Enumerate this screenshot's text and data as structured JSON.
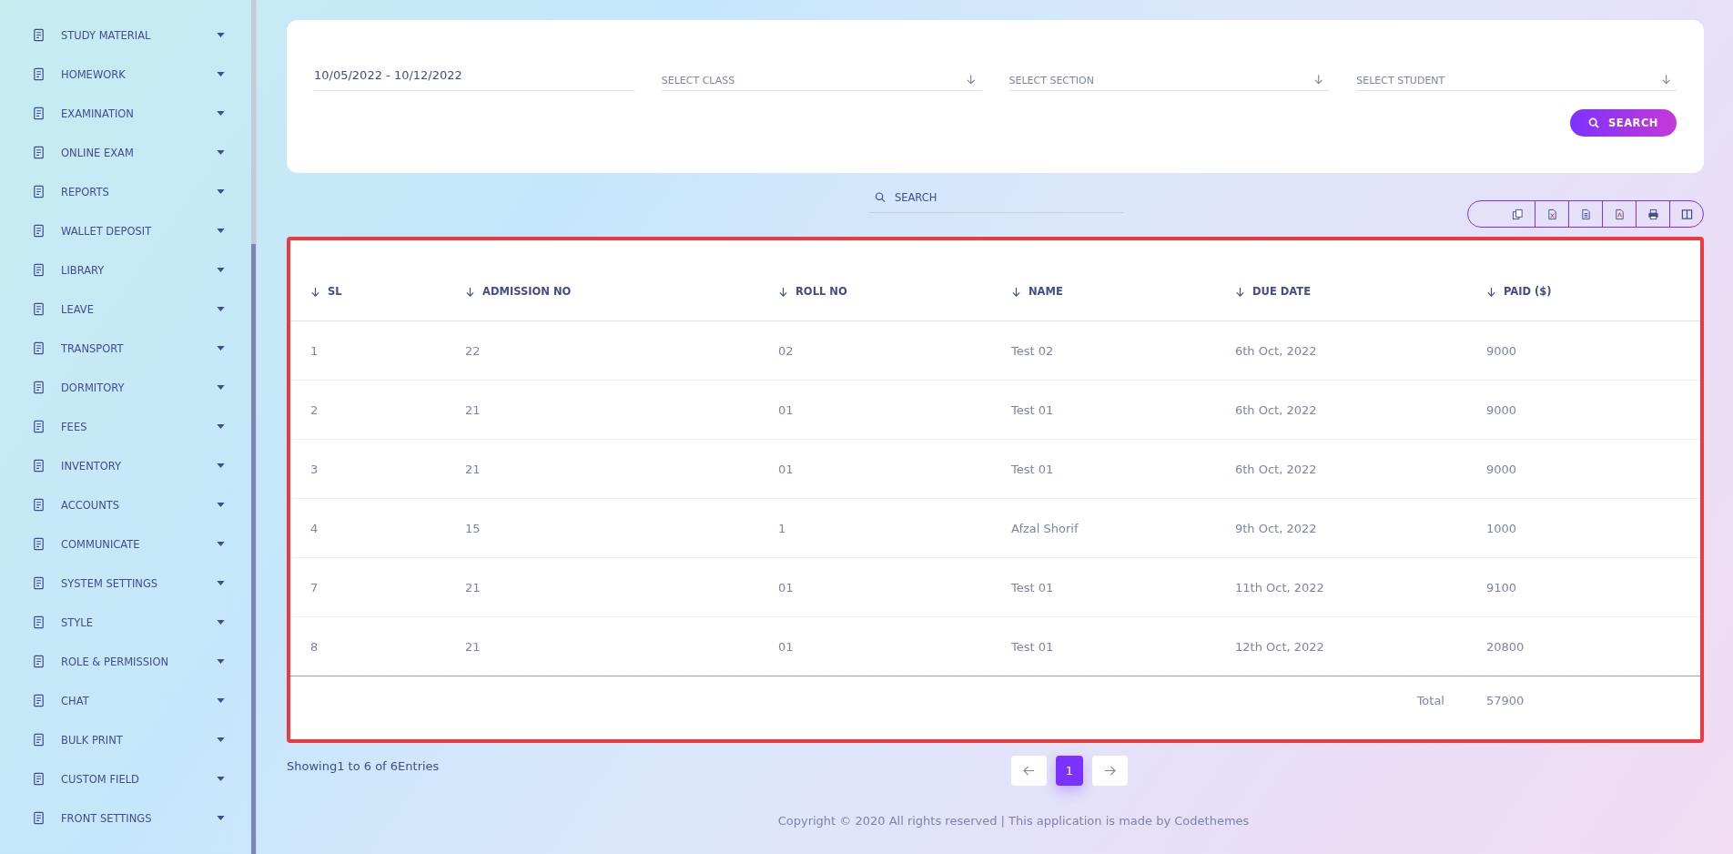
{
  "sidebar": {
    "items": [
      {
        "label": "STUDY MATERIAL"
      },
      {
        "label": "HOMEWORK"
      },
      {
        "label": "EXAMINATION"
      },
      {
        "label": "ONLINE EXAM"
      },
      {
        "label": "REPORTS"
      },
      {
        "label": "WALLET DEPOSIT"
      },
      {
        "label": "LIBRARY"
      },
      {
        "label": "LEAVE"
      },
      {
        "label": "TRANSPORT"
      },
      {
        "label": "DORMITORY"
      },
      {
        "label": "FEES"
      },
      {
        "label": "INVENTORY"
      },
      {
        "label": "ACCOUNTS"
      },
      {
        "label": "COMMUNICATE"
      },
      {
        "label": "SYSTEM SETTINGS"
      },
      {
        "label": "STYLE"
      },
      {
        "label": "ROLE & PERMISSION"
      },
      {
        "label": "CHAT"
      },
      {
        "label": "BULK PRINT"
      },
      {
        "label": "CUSTOM FIELD"
      },
      {
        "label": "FRONT SETTINGS"
      }
    ]
  },
  "filters": {
    "date_range": "10/05/2022 - 10/12/2022",
    "class": {
      "placeholder": "SELECT CLASS"
    },
    "section": {
      "placeholder": "SELECT SECTION"
    },
    "student": {
      "placeholder": "SELECT STUDENT"
    },
    "search_button": "SEARCH"
  },
  "table_search": {
    "placeholder": "SEARCH"
  },
  "table": {
    "columns": [
      "SL",
      "ADMISSION NO",
      "ROLL NO",
      "NAME",
      "DUE DATE",
      "PAID ($)"
    ],
    "rows": [
      [
        "1",
        "22",
        "02",
        "Test 02",
        "6th Oct, 2022",
        "9000"
      ],
      [
        "2",
        "21",
        "01",
        "Test 01",
        "6th Oct, 2022",
        "9000"
      ],
      [
        "3",
        "21",
        "01",
        "Test 01",
        "6th Oct, 2022",
        "9000"
      ],
      [
        "4",
        "15",
        "1",
        "Afzal Shorif",
        "9th Oct, 2022",
        "1000"
      ],
      [
        "7",
        "21",
        "01",
        "Test 01",
        "11th Oct, 2022",
        "9100"
      ],
      [
        "8",
        "21",
        "01",
        "Test 01",
        "12th Oct, 2022",
        "20800"
      ]
    ],
    "total_label": "Total",
    "total_value": "57900"
  },
  "pagination": {
    "info": "Showing1 to 6 of 6Entries",
    "pages": [
      {
        "label": "1",
        "selected": true
      }
    ]
  },
  "footer": "Copyright © 2020 All rights reserved | This application is made by Codethemes"
}
